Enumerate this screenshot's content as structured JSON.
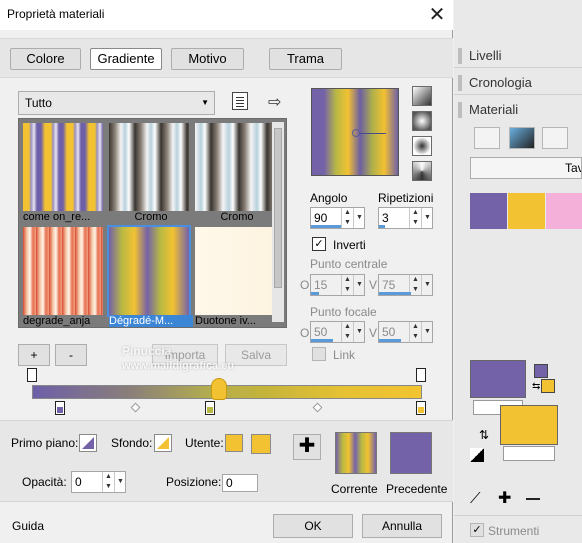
{
  "dialog": {
    "title": "Proprietà materiali",
    "tabs": [
      "Colore",
      "Gradiente",
      "Motivo",
      "Trama"
    ],
    "active_tab": "Gradiente",
    "category": "Tutto",
    "gradients": [
      {
        "label": "come on_re...",
        "selected": false
      },
      {
        "label": "Cromo",
        "selected": false
      },
      {
        "label": "Cromo",
        "selected": false
      },
      {
        "label": "degrade_anja",
        "selected": false
      },
      {
        "label": "Dégradé-M...",
        "selected": true
      },
      {
        "label": "Duotone iv...",
        "selected": false
      }
    ],
    "buttons": {
      "add": "+",
      "remove": "-",
      "import": "Importa",
      "save": "Salva"
    },
    "angle": {
      "label": "Angolo",
      "value": "90"
    },
    "repeats": {
      "label": "Ripetizioni",
      "value": "3"
    },
    "invert": {
      "label": "Inverti",
      "checked": true
    },
    "center_point": {
      "label": "Punto centrale",
      "o_label": "O",
      "o_value": "15",
      "v_label": "V",
      "v_value": "75"
    },
    "focal_point": {
      "label": "Punto focale",
      "o_label": "O",
      "o_value": "50",
      "v_label": "V",
      "v_value": "50"
    },
    "link": {
      "label": "Link",
      "checked": false
    },
    "foreground": {
      "label": "Primo piano:"
    },
    "background": {
      "label": "Sfondo:"
    },
    "user": {
      "label": "Utente:"
    },
    "opacity": {
      "label": "Opacità:",
      "value": "0"
    },
    "position": {
      "label": "Posizione:",
      "value": "0"
    },
    "current_label": "Corrente",
    "previous_label": "Precedente",
    "help": "Guida",
    "ok": "OK",
    "cancel": "Annulla",
    "watermark": {
      "line1": "Pinuccia",
      "line2": "www.maildigrafica.eu"
    }
  },
  "colors": {
    "purple": "#7462a8",
    "yellow": "#f2c232",
    "olive": "#b8b844",
    "pink": "#f4b0d8",
    "accent": "#3c86d8"
  },
  "right_panel": {
    "sections": [
      "Livelli",
      "Cronologia",
      "Materiali"
    ],
    "tab_partial": "Tav",
    "tools": "Strumenti"
  }
}
